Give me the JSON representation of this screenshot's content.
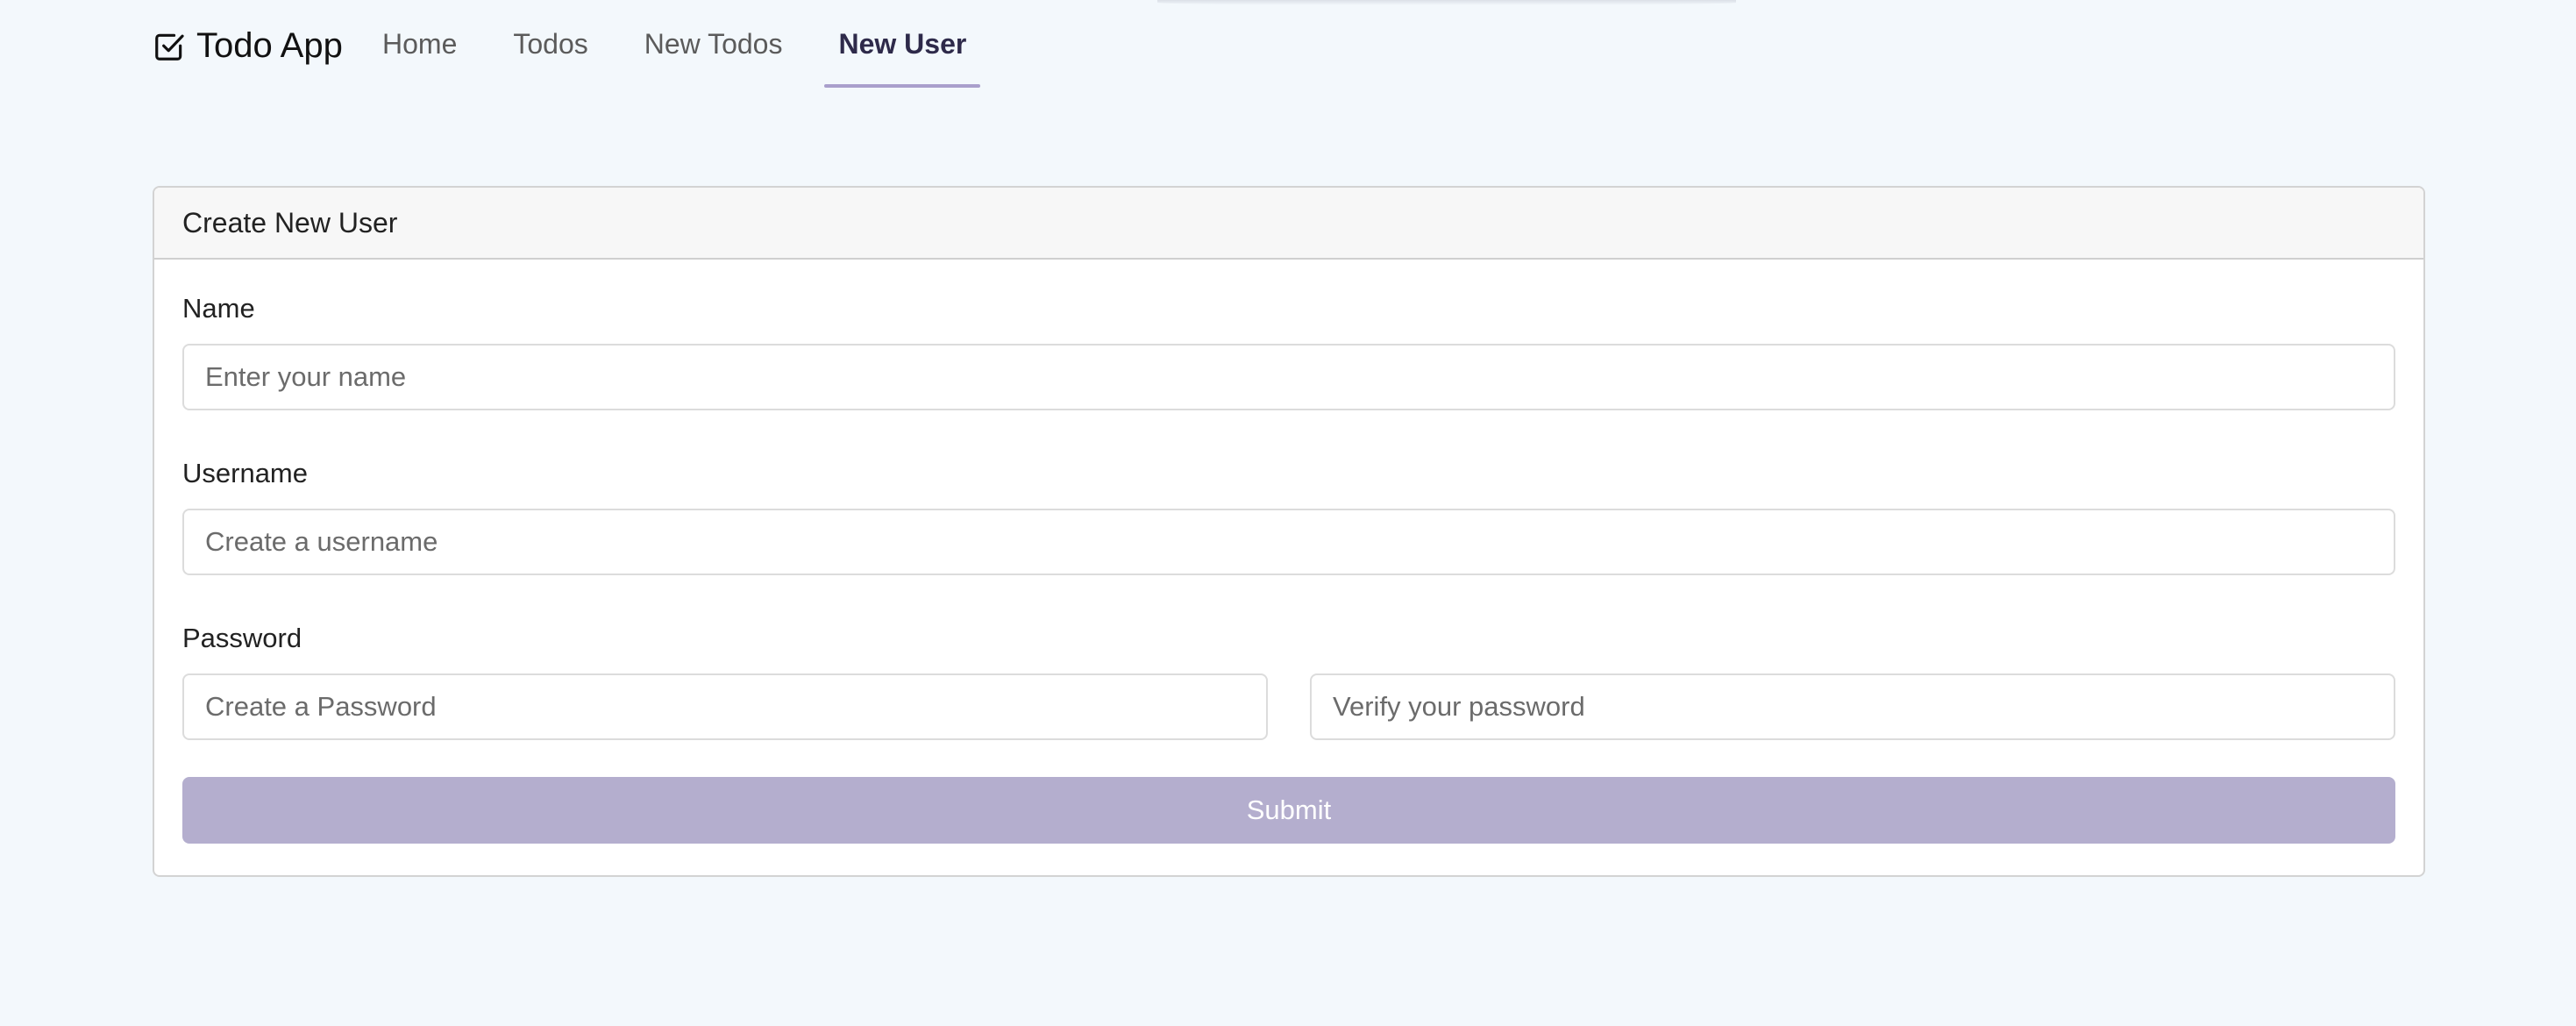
{
  "app": {
    "brand": "Todo App",
    "brand_icon": "checkbox-icon"
  },
  "nav": {
    "items": [
      {
        "label": "Home",
        "active": false
      },
      {
        "label": "Todos",
        "active": false
      },
      {
        "label": "New Todos",
        "active": false
      },
      {
        "label": "New User",
        "active": true
      }
    ]
  },
  "form": {
    "title": "Create New User",
    "name_label": "Name",
    "name_placeholder": "Enter your name",
    "username_label": "Username",
    "username_placeholder": "Create a username",
    "password_label": "Password",
    "password_placeholder": "Create a Password",
    "verify_placeholder": "Verify your password",
    "submit_label": "Submit"
  },
  "colors": {
    "background": "#f3f8fc",
    "accent": "#a99fcc",
    "submit_bg": "#b4aece"
  }
}
